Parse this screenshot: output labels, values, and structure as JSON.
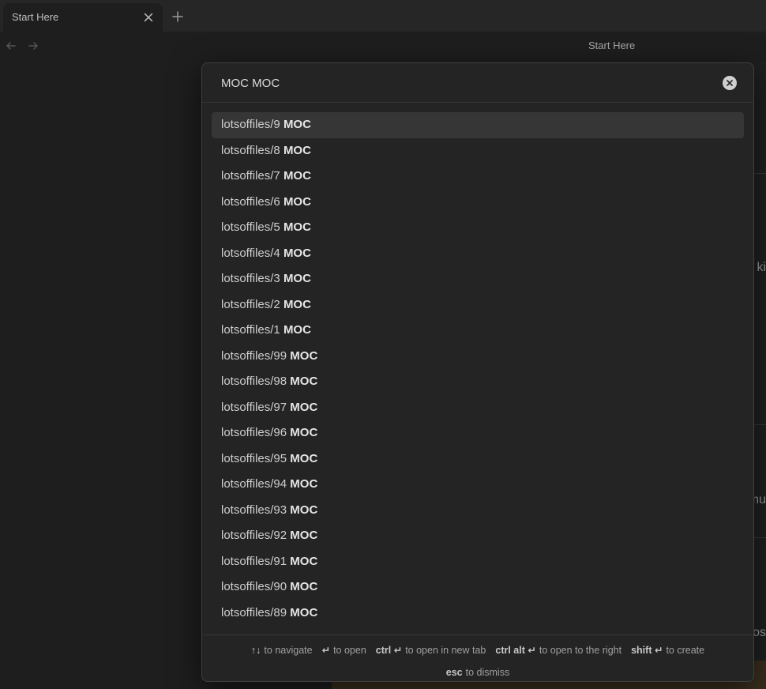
{
  "tabbar": {
    "tab_title": "Start Here",
    "close_icon": "close-icon",
    "new_tab_icon": "plus-icon"
  },
  "nav": {
    "back_icon": "arrow-left-icon",
    "forward_icon": "arrow-right-icon",
    "view_title": "Start Here"
  },
  "background": {
    "fragments": [
      "ki",
      "mu",
      "os"
    ]
  },
  "search": {
    "value": "MOC MOC",
    "clear_icon": "clear-icon"
  },
  "results": [
    {
      "prefix": "lotsoffiles/9 ",
      "match": "MOC"
    },
    {
      "prefix": "lotsoffiles/8 ",
      "match": "MOC"
    },
    {
      "prefix": "lotsoffiles/7 ",
      "match": "MOC"
    },
    {
      "prefix": "lotsoffiles/6 ",
      "match": "MOC"
    },
    {
      "prefix": "lotsoffiles/5 ",
      "match": "MOC"
    },
    {
      "prefix": "lotsoffiles/4 ",
      "match": "MOC"
    },
    {
      "prefix": "lotsoffiles/3 ",
      "match": "MOC"
    },
    {
      "prefix": "lotsoffiles/2 ",
      "match": "MOC"
    },
    {
      "prefix": "lotsoffiles/1 ",
      "match": "MOC"
    },
    {
      "prefix": "lotsoffiles/99 ",
      "match": "MOC"
    },
    {
      "prefix": "lotsoffiles/98 ",
      "match": "MOC"
    },
    {
      "prefix": "lotsoffiles/97 ",
      "match": "MOC"
    },
    {
      "prefix": "lotsoffiles/96 ",
      "match": "MOC"
    },
    {
      "prefix": "lotsoffiles/95 ",
      "match": "MOC"
    },
    {
      "prefix": "lotsoffiles/94 ",
      "match": "MOC"
    },
    {
      "prefix": "lotsoffiles/93 ",
      "match": "MOC"
    },
    {
      "prefix": "lotsoffiles/92 ",
      "match": "MOC"
    },
    {
      "prefix": "lotsoffiles/91 ",
      "match": "MOC"
    },
    {
      "prefix": "lotsoffiles/90 ",
      "match": "MOC"
    },
    {
      "prefix": "lotsoffiles/89 ",
      "match": "MOC"
    }
  ],
  "instructions": [
    {
      "key": "↑↓",
      "text": "to navigate"
    },
    {
      "key": "↵",
      "text": "to open"
    },
    {
      "key": "ctrl ↵",
      "text": "to open in new tab"
    },
    {
      "key": "ctrl alt ↵",
      "text": "to open to the right"
    },
    {
      "key": "shift ↵",
      "text": "to create"
    },
    {
      "key": "esc",
      "text": "to dismiss"
    }
  ],
  "colors": {
    "background": "#1e1e1e",
    "modal": "#242424",
    "selected_row": "#363636"
  }
}
